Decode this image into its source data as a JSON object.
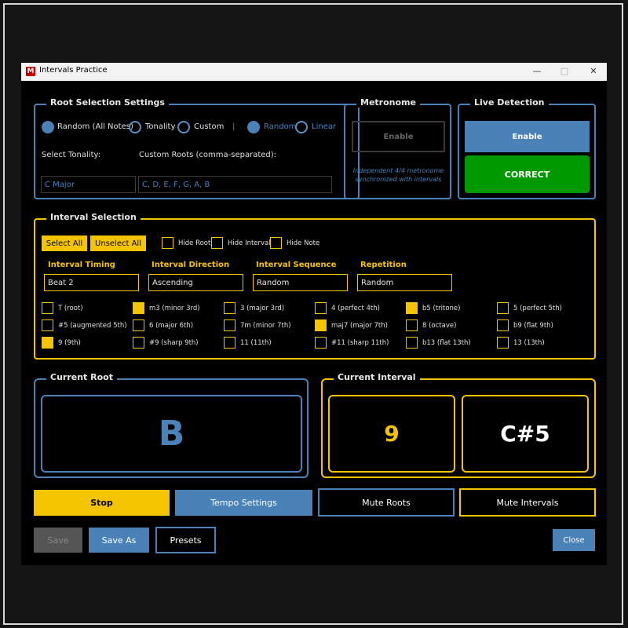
{
  "window": {
    "title": "Intervals Practice",
    "icon_label": "M"
  },
  "controls": {
    "minimize": "—",
    "maximize": "□",
    "close": "✕"
  },
  "root_settings": {
    "title": "Root Selection Settings",
    "radios": [
      "Random (All Notes)",
      "Tonality",
      "Custom"
    ],
    "separator": "|",
    "order_radios": [
      "Random",
      "Linear"
    ],
    "tonality_label": "Select Tonality:",
    "tonality_value": "C Major",
    "custom_label": "Custom Roots (comma-separated):",
    "custom_value": "C, D, E, F, G, A, B"
  },
  "metronome": {
    "title": "Metronome",
    "enable_label": "Enable",
    "note": "Independent 4/4 metronome synchronized with intervals"
  },
  "live_detection": {
    "title": "Live Detection",
    "enable_label": "Enable",
    "status": "CORRECT"
  },
  "interval_selection": {
    "title": "Interval Selection",
    "select_all": "Select All",
    "unselect_all": "Unselect All",
    "hide_root": "Hide Root",
    "hide_interval": "Hide Interval",
    "hide_note": "Hide Note",
    "timing_label": "Interval Timing",
    "timing_value": "Beat 2",
    "direction_label": "Interval Direction",
    "direction_value": "Ascending",
    "sequence_label": "Interval Sequence",
    "sequence_value": "Random",
    "repetition_label": "Repetition",
    "repetition_value": "Random",
    "intervals": [
      {
        "label": "T (root)",
        "checked": false
      },
      {
        "label": "m3 (minor 3rd)",
        "checked": true
      },
      {
        "label": "3 (major 3rd)",
        "checked": false
      },
      {
        "label": "4 (perfect 4th)",
        "checked": false
      },
      {
        "label": "b5 (tritone)",
        "checked": true
      },
      {
        "label": "5 (perfect 5th)",
        "checked": false
      },
      {
        "label": "#5 (augmented 5th)",
        "checked": false
      },
      {
        "label": "6 (major 6th)",
        "checked": false
      },
      {
        "label": "7m (minor 7th)",
        "checked": false
      },
      {
        "label": "maj7 (major 7th)",
        "checked": true
      },
      {
        "label": "8 (octave)",
        "checked": false
      },
      {
        "label": "b9 (flat 9th)",
        "checked": false
      },
      {
        "label": "9 (9th)",
        "checked": true
      },
      {
        "label": "#9 (sharp 9th)",
        "checked": false
      },
      {
        "label": "11 (11th)",
        "checked": false
      },
      {
        "label": "#11 (sharp 11th)",
        "checked": false
      },
      {
        "label": "b13 (flat 13th)",
        "checked": false
      },
      {
        "label": "13 (13th)",
        "checked": false
      }
    ]
  },
  "current_root": {
    "title": "Current Root",
    "value": "B"
  },
  "current_interval": {
    "title": "Current Interval",
    "interval": "9",
    "note": "C#5"
  },
  "actions": {
    "stop": "Stop",
    "tempo": "Tempo Settings",
    "mute_roots": "Mute Roots",
    "mute_intervals": "Mute Intervals"
  },
  "footer": {
    "save": "Save",
    "save_as": "Save As",
    "presets": "Presets",
    "close": "Close"
  },
  "colors": {
    "accent_blue": "#4a82b8",
    "accent_yellow": "#f5c400",
    "success_green": "#009a00"
  }
}
